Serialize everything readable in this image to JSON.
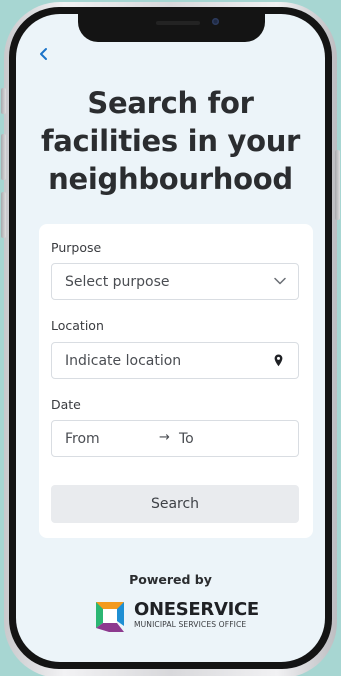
{
  "headline": {
    "line1": "Search for",
    "line2": "facilities in your",
    "line3": "neighbourhood"
  },
  "back_icon": "chevron-left-icon",
  "form": {
    "purpose": {
      "label": "Purpose",
      "placeholder": "Select purpose",
      "icon": "chevron-down-icon"
    },
    "location": {
      "label": "Location",
      "placeholder": "Indicate location",
      "icon": "map-pin-icon"
    },
    "date": {
      "label": "Date",
      "from": "From",
      "arrow": "→",
      "to": "To"
    },
    "search_label": "Search"
  },
  "footer": {
    "powered_by": "Powered by",
    "brand_name": "ONESERVICE",
    "brand_tagline": "MUNICIPAL SERVICES OFFICE"
  },
  "colors": {
    "background": "#a7d6d2",
    "screen": "#ecf4f9",
    "accent": "#1a73c9",
    "logo_orange": "#f39a1e",
    "logo_green": "#2bb673",
    "logo_blue": "#1f8fd3",
    "logo_purple": "#8d3a8f"
  }
}
